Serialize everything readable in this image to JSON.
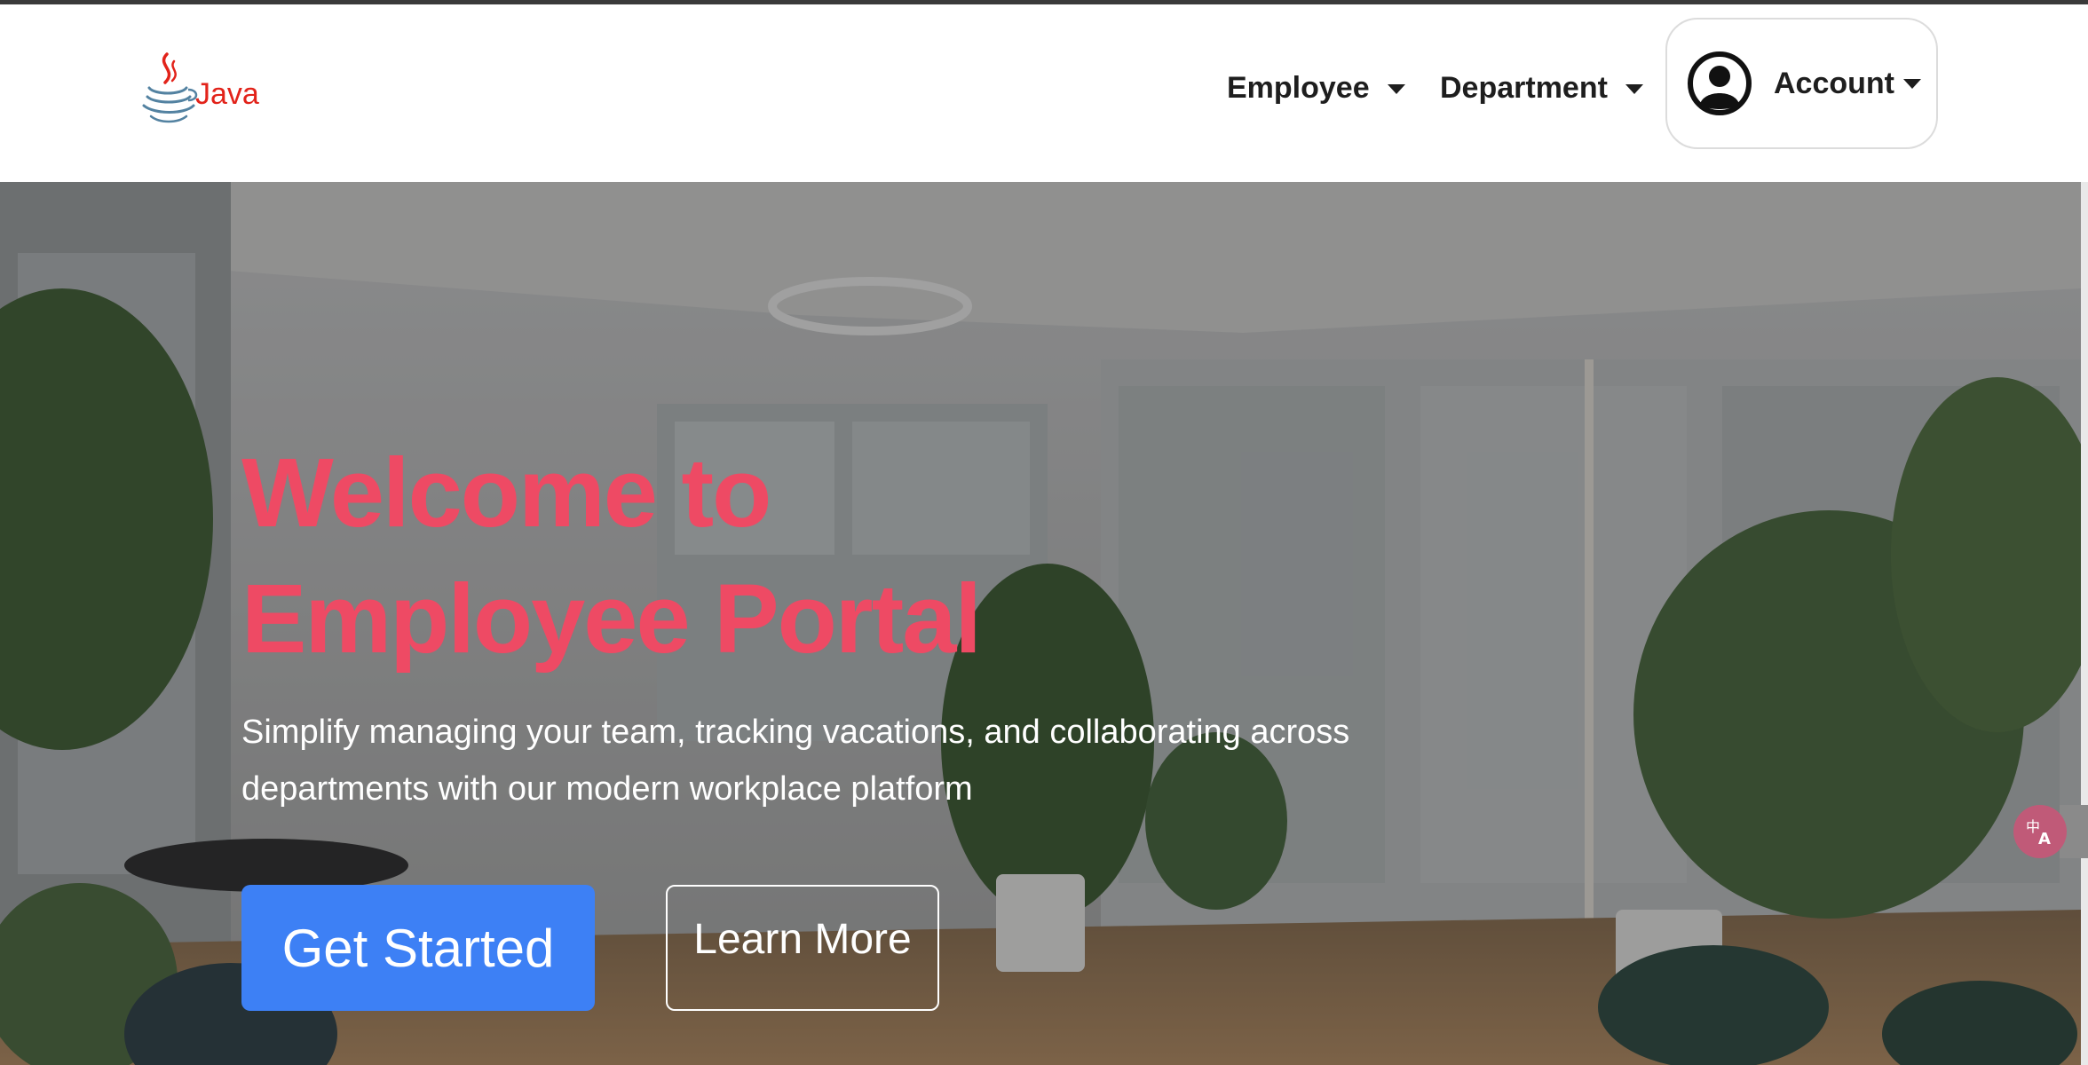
{
  "brand": {
    "logo_text": "Java"
  },
  "nav": {
    "employee": "Employee",
    "department": "Department",
    "account": "Account"
  },
  "hero": {
    "title_line1": "Welcome to",
    "title_line2": "Employee Portal",
    "subtitle_line1": "Simplify managing your team, tracking vacations, and collaborating across",
    "subtitle_line2": "departments with our modern workplace platform",
    "primary_button": "Get Started",
    "secondary_button": "Learn More"
  },
  "icons": {
    "logo": "java-coffee-cup-icon",
    "avatar": "user-circle-icon",
    "translate": "translate-icon"
  },
  "colors": {
    "accent_pink": "#ee4a64",
    "primary_blue": "#3d80f5",
    "java_red": "#e2231a",
    "java_blue": "#5382a1"
  }
}
